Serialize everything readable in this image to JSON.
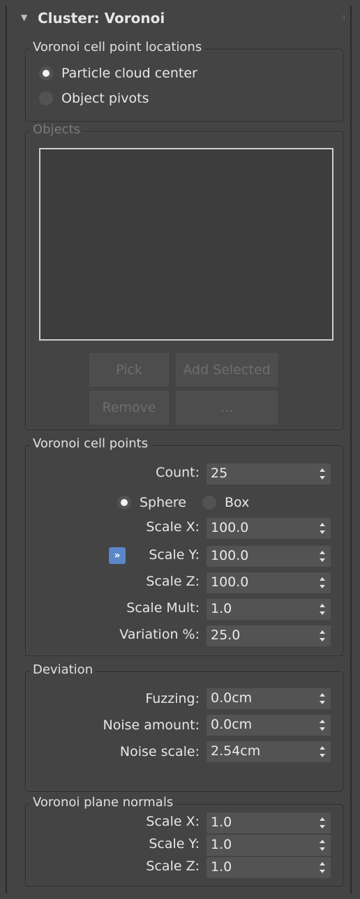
{
  "rollout": {
    "title": "Cluster: Voronoi"
  },
  "cell_locations": {
    "legend": "Voronoi cell point locations",
    "options": [
      {
        "label": "Particle cloud center",
        "selected": true
      },
      {
        "label": "Object pivots",
        "selected": false
      }
    ]
  },
  "objects": {
    "legend": "Objects",
    "buttons": {
      "pick": "Pick",
      "add_selected": "Add Selected",
      "remove": "Remove",
      "more": "..."
    }
  },
  "cell_points": {
    "legend": "Voronoi cell points",
    "count_label": "Count:",
    "count_value": "25",
    "shape_options": [
      {
        "label": "Sphere",
        "selected": true
      },
      {
        "label": "Box",
        "selected": false
      }
    ],
    "lock_icon": "»",
    "scale_x_label": "Scale X:",
    "scale_x_value": "100.0",
    "scale_y_label": "Scale Y:",
    "scale_y_value": "100.0",
    "scale_z_label": "Scale Z:",
    "scale_z_value": "100.0",
    "scale_mult_label": "Scale Mult:",
    "scale_mult_value": "1.0",
    "variation_label": "Variation %:",
    "variation_value": "25.0"
  },
  "deviation": {
    "legend": "Deviation",
    "fuzzing_label": "Fuzzing:",
    "fuzzing_value": "0.0cm",
    "noise_amount_label": "Noise amount:",
    "noise_amount_value": "0.0cm",
    "noise_scale_label": "Noise scale:",
    "noise_scale_value": "2.54cm"
  },
  "plane_normals": {
    "legend": "Voronoi plane normals",
    "scale_x_label": "Scale X:",
    "scale_x_value": "1.0",
    "scale_y_label": "Scale Y:",
    "scale_y_value": "1.0",
    "scale_z_label": "Scale Z:",
    "scale_z_value": "1.0"
  },
  "colors": {
    "panel_bg": "#444444",
    "field_bg": "#535353",
    "accent_blue": "#5b87c8"
  }
}
